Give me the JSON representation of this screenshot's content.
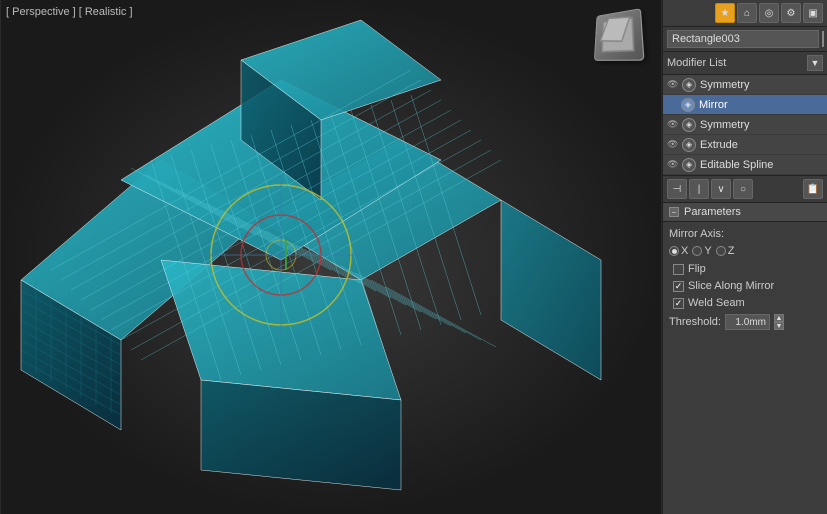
{
  "viewport": {
    "label": "[ Perspective ] [ Realistic ]"
  },
  "right_panel": {
    "top_toolbar": {
      "icons": [
        "★",
        "⌂",
        "⊙",
        "⚙",
        "📷"
      ]
    },
    "object_name": "Rectangle003",
    "modifier_list_label": "Modifier List",
    "modifiers": [
      {
        "id": "sym1",
        "name": "Symmetry",
        "level": 0,
        "selected": false
      },
      {
        "id": "mirror",
        "name": "Mirror",
        "level": 1,
        "selected": true
      },
      {
        "id": "sym2",
        "name": "Symmetry",
        "level": 0,
        "selected": false
      },
      {
        "id": "extrude",
        "name": "Extrude",
        "level": 0,
        "selected": false
      },
      {
        "id": "editable_spline",
        "name": "Editable Spline",
        "level": 0,
        "selected": false
      }
    ],
    "secondary_toolbar": {
      "icons": [
        "⊣",
        "|",
        "∨",
        "○",
        "📋"
      ]
    },
    "parameters": {
      "section_title": "Parameters",
      "mirror_axis_label": "Mirror Axis:",
      "axes": [
        {
          "id": "x",
          "label": "X",
          "checked": true
        },
        {
          "id": "y",
          "label": "Y",
          "checked": false
        },
        {
          "id": "z",
          "label": "Z",
          "checked": false
        }
      ],
      "flip_label": "Flip",
      "flip_checked": false,
      "slice_along_mirror_label": "Slice Along Mirror",
      "slice_along_mirror_checked": true,
      "weld_seam_label": "Weld Seam",
      "weld_seam_checked": true,
      "threshold_label": "Threshold:",
      "threshold_value": "1.0mm"
    }
  }
}
